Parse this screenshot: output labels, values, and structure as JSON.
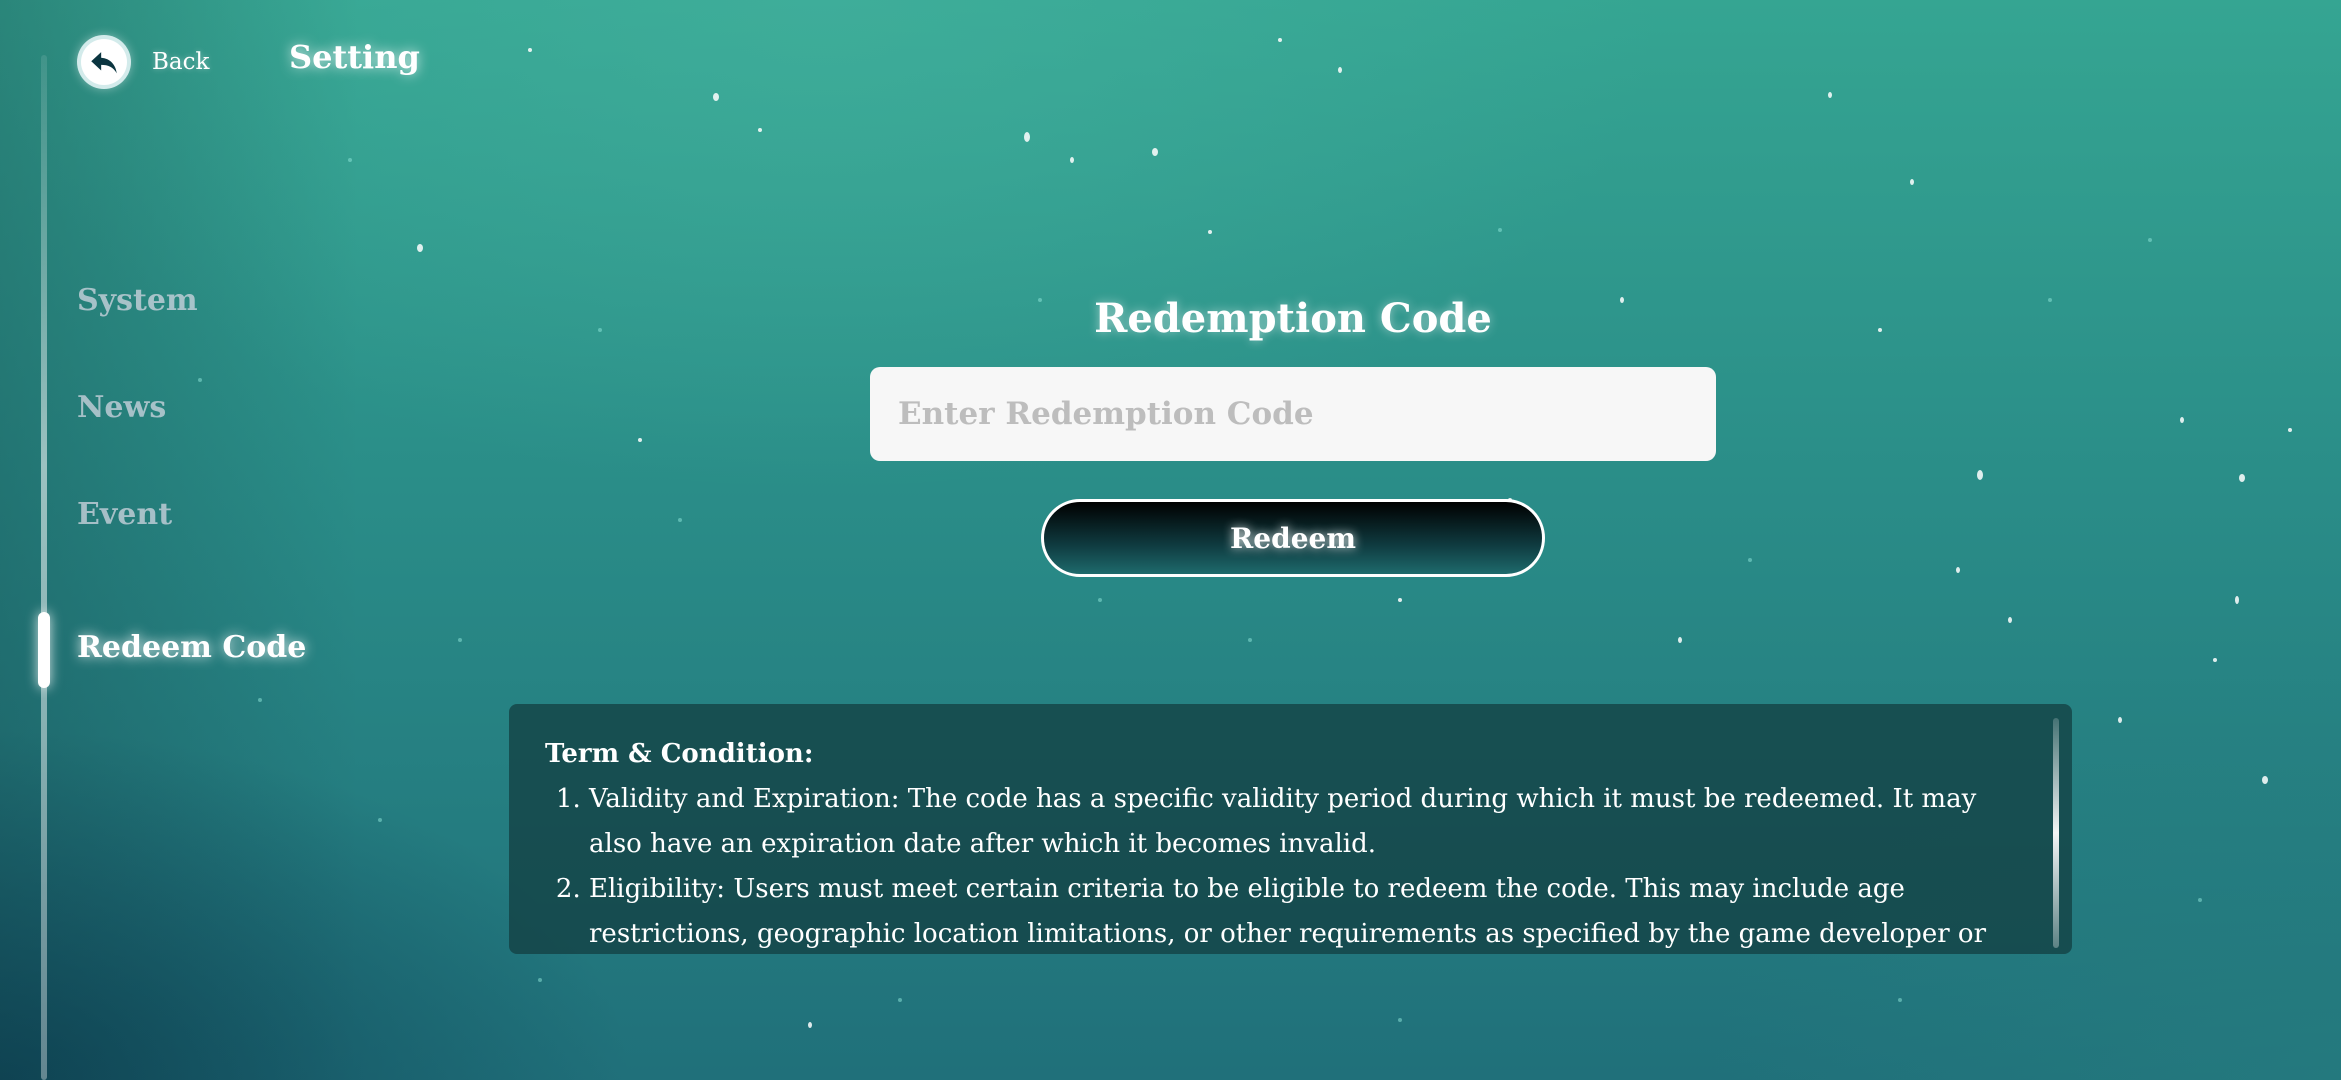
{
  "header": {
    "back_label": "Back",
    "title": "Setting"
  },
  "sidebar": {
    "items": [
      {
        "label": "System",
        "active": false
      },
      {
        "label": "News",
        "active": false
      },
      {
        "label": "Event",
        "active": false
      },
      {
        "label": "Redeem Code",
        "active": true
      }
    ]
  },
  "redeem": {
    "heading": "Redemption Code",
    "input_value": "",
    "input_placeholder": "Enter Redemption Code",
    "button_label": "Redeem"
  },
  "terms": {
    "title": "Term & Condition:",
    "items": [
      "Validity and Expiration: The code has a specific validity period during which it must be redeemed. It may also have an expiration date after which it becomes invalid.",
      "Eligibility: Users must meet certain criteria to be eligible to redeem the code. This may include age restrictions, geographic location limitations, or other requirements as specified by the game developer or platform."
    ]
  },
  "icons": {
    "back": "back-arrow-icon"
  },
  "colors": {
    "background_top": "#35a592",
    "background_bottom": "#20707a",
    "input_background": "#f7f7f7",
    "button_dark": "#000000",
    "terms_panel": "#123c3e"
  }
}
